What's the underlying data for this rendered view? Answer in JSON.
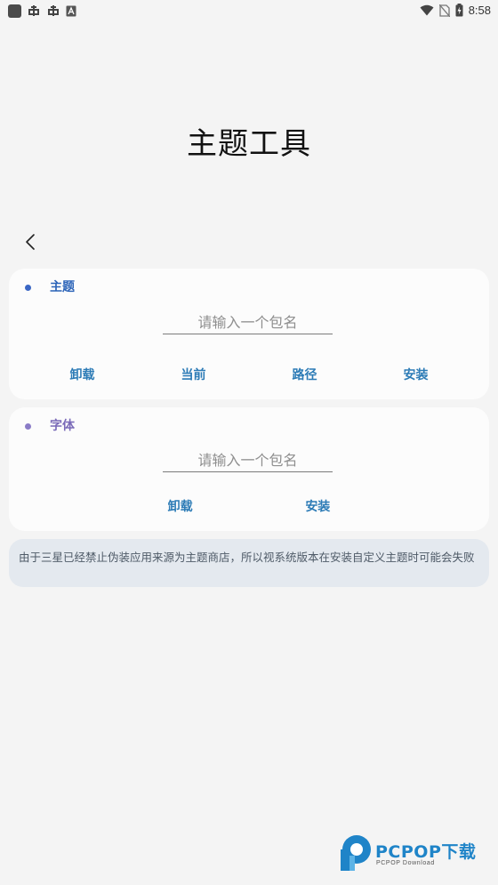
{
  "status_bar": {
    "time": "8:58",
    "left_icons": [
      "app-square-icon",
      "bug-icon",
      "bug-icon",
      "text-a-icon"
    ],
    "right_icons": [
      "wifi-icon",
      "no-sim-icon",
      "battery-charging-icon"
    ]
  },
  "page": {
    "title": "主题工具",
    "back_icon": "chevron-left-icon"
  },
  "theme_card": {
    "label": "主题",
    "dot_color": "#3a66c4",
    "label_color": "#2b63b8",
    "input_value": "",
    "input_placeholder": "请输入一个包名",
    "buttons": [
      "卸载",
      "当前",
      "路径",
      "安装"
    ]
  },
  "font_card": {
    "label": "字体",
    "dot_color": "#8a7cc7",
    "label_color": "#7a6ab8",
    "input_value": "",
    "input_placeholder": "请输入一个包名",
    "buttons": [
      "卸载",
      "安装"
    ]
  },
  "notice": {
    "text": "由于三星已经禁止伪装应用来源为主题商店，所以视系统版本在安装自定义主题时可能会失败"
  },
  "watermark": {
    "brand": "PCPOP下载",
    "sub": "PCPOP Download",
    "color": "#1f84c8"
  },
  "colors": {
    "accent_button": "#2c7bb6",
    "background": "#f4f4f4",
    "card": "#fcfcfc",
    "notice_bg": "#e4e9ef"
  }
}
